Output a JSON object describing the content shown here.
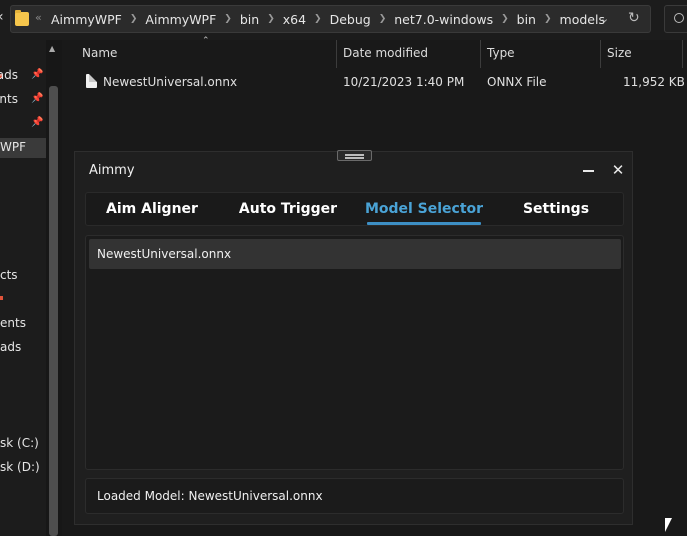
{
  "explorer": {
    "breadcrumbs": [
      "AimmyWPF",
      "AimmyWPF",
      "bin",
      "x64",
      "Debug",
      "net7.0-windows",
      "bin",
      "models"
    ],
    "nav_items": [
      {
        "label": "ads",
        "pinned": true
      },
      {
        "label": "ents",
        "pinned": true
      },
      {
        "label": "",
        "pinned": true
      },
      {
        "label": "WPF",
        "pinned": false,
        "selected": true
      },
      {
        "label": "cts",
        "pinned": false
      },
      {
        "label": "ents",
        "pinned": false
      },
      {
        "label": "ads",
        "pinned": false
      },
      {
        "label": "sk (C:)",
        "pinned": false
      },
      {
        "label": "sk (D:)",
        "pinned": false
      }
    ],
    "columns": {
      "name": "Name",
      "date": "Date modified",
      "type": "Type",
      "size": "Size"
    },
    "files": [
      {
        "name": "NewestUniversal.onnx",
        "date": "10/21/2023 1:40 PM",
        "type": "ONNX File",
        "size": "11,952 KB"
      }
    ]
  },
  "aimmy": {
    "title": "Aimmy",
    "tabs": [
      {
        "label": "Aim Aligner",
        "active": false
      },
      {
        "label": "Auto Trigger",
        "active": false
      },
      {
        "label": "Model Selector",
        "active": true
      },
      {
        "label": "Settings",
        "active": false
      }
    ],
    "models": [
      "NewestUniversal.onnx"
    ],
    "status": "Loaded Model: NewestUniversal.onnx"
  },
  "colors": {
    "accent": "#4aa3d6",
    "window_bg": "#1f1f1f",
    "explorer_bg": "#191919"
  }
}
